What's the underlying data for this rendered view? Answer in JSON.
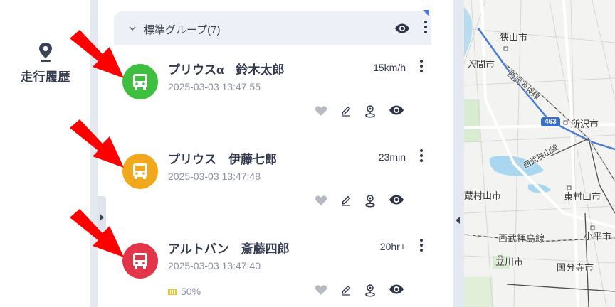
{
  "rail": {
    "item_label": "走行履歴",
    "icon": "location-pin-icon"
  },
  "group": {
    "title": "標準グループ(7)"
  },
  "vehicles": [
    {
      "name": "プリウスα　鈴木太郎",
      "timestamp": "2025-03-03 13:47:55",
      "status": "15km/h",
      "avatar_color": "#3fbf3f",
      "battery": ""
    },
    {
      "name": "プリウス　伊藤七郎",
      "timestamp": "2025-03-03 13:47:48",
      "status": "23min",
      "avatar_color": "#f2a81c",
      "battery": ""
    },
    {
      "name": "アルトバン　斎藤四郎",
      "timestamp": "2025-03-03 13:47:40",
      "status": "20hr+",
      "avatar_color": "#e2354a",
      "battery": "50%"
    }
  ],
  "map": {
    "labels": [
      "狭山市",
      "入間市",
      "西武池袋線",
      "所沢市",
      "西武狭山線",
      "蔵村山市",
      "東村山市",
      "西武拝島線",
      "小平市",
      "立川市",
      "国分寺市"
    ],
    "route_number": "463"
  },
  "colors": {
    "accent": "#4b76d8",
    "arrow": "#ff0000"
  }
}
